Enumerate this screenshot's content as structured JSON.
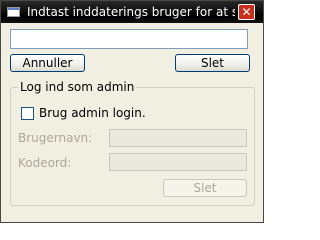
{
  "window": {
    "title": "Indtast inddaterings bruger for at sl...",
    "close_glyph": "✕"
  },
  "top_input": {
    "value": "",
    "placeholder": ""
  },
  "buttons": {
    "cancel_label": "Annuller",
    "delete_label": "Slet"
  },
  "admin_group": {
    "title": "Log ind som admin",
    "checkbox_label": "Brug admin login.",
    "checkbox_checked": false,
    "username_label": "Brugernavn:",
    "username_value": "",
    "password_label": "Kodeord:",
    "password_value": "",
    "delete_label": "Slet"
  },
  "colors": {
    "titlebar": "#000000",
    "close_button": "#c8311e",
    "window_bg": "#f1efe2",
    "disabled_text": "#aca899"
  }
}
